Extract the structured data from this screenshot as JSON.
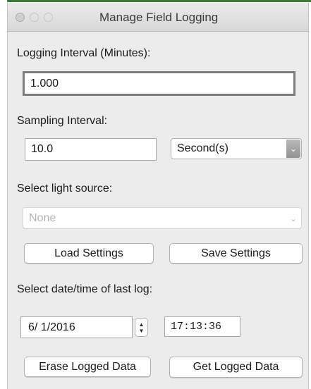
{
  "window": {
    "title": "Manage Field Logging"
  },
  "logging_interval": {
    "label": "Logging Interval (Minutes):",
    "value": "1.000"
  },
  "sampling_interval": {
    "label": "Sampling Interval:",
    "value": "10.0",
    "unit_selected": "Second(s)"
  },
  "light_source": {
    "label": "Select light source:",
    "selected": "None"
  },
  "settings_buttons": {
    "load": "Load Settings",
    "save": "Save Settings"
  },
  "last_log": {
    "label": "Select date/time of last log:",
    "date": "6/  1/2016",
    "time": "17:13:36"
  },
  "data_buttons": {
    "erase": "Erase Logged Data",
    "get": "Get Logged Data"
  },
  "icons": {
    "close": "close-traffic-light",
    "minimize": "minimize-traffic-light",
    "zoom": "zoom-traffic-light",
    "dropdown": "chevron-down-icon",
    "stepper": "up-down-stepper-icon"
  },
  "colors": {
    "window_bg": "#ececec",
    "top_accent": "#3e7a3a"
  }
}
